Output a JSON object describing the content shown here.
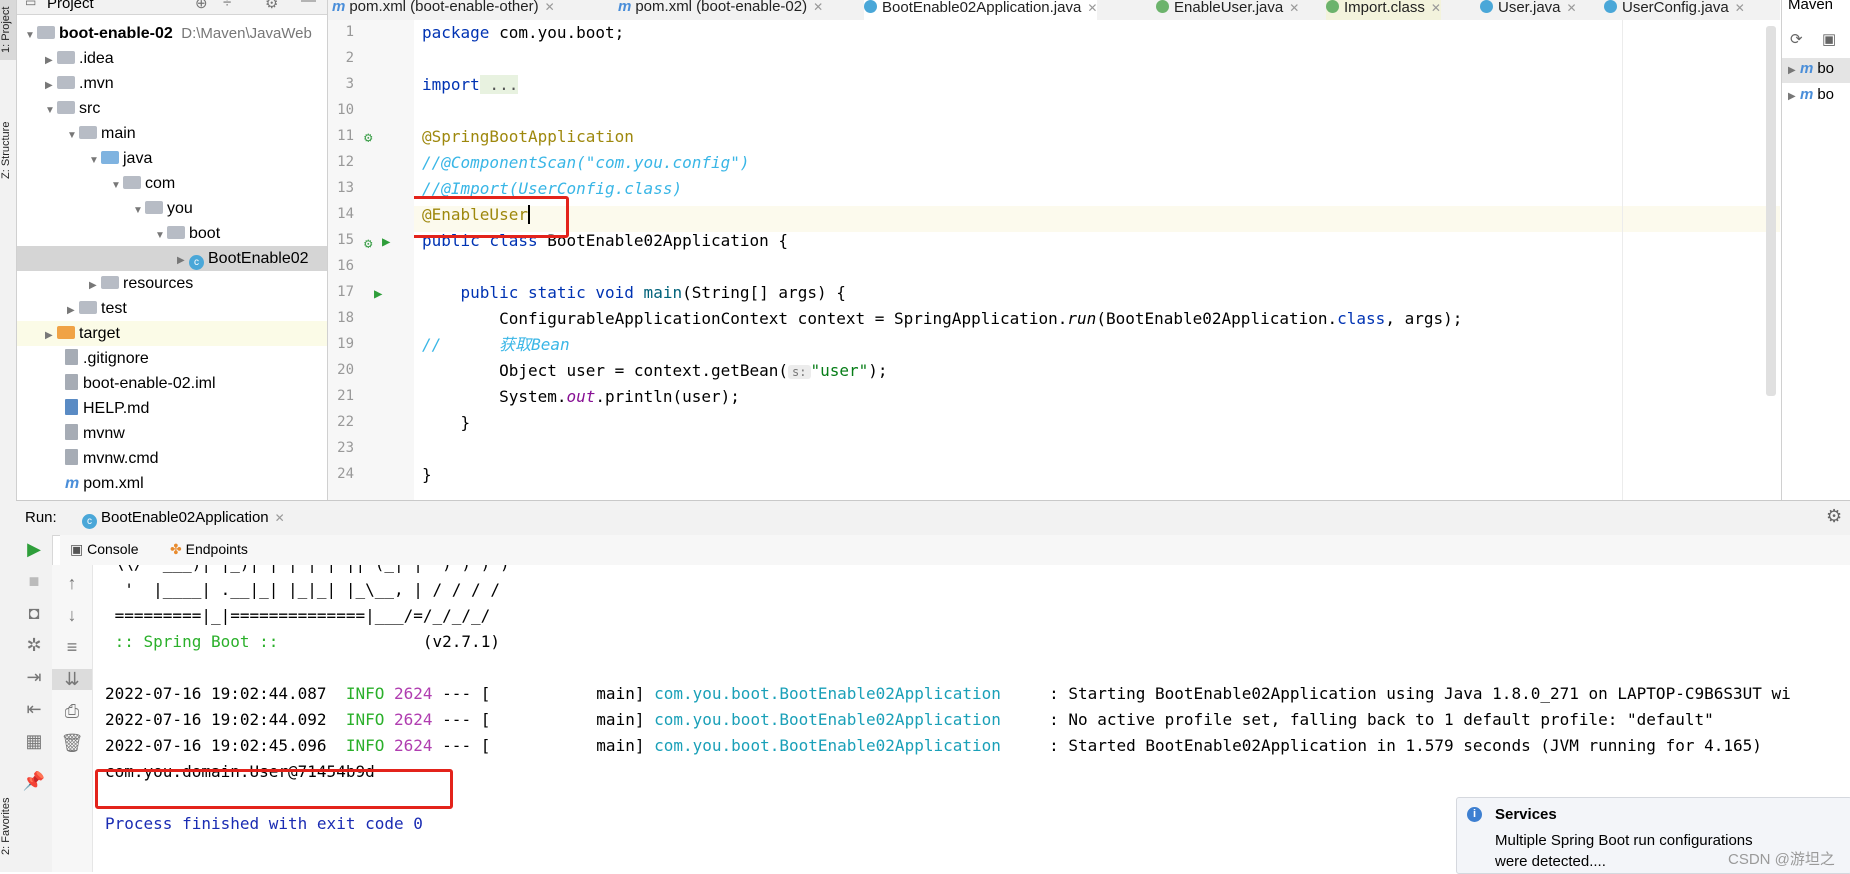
{
  "left_strip": {
    "project_tab": "1: Project",
    "structure_tab": "Z: Structure",
    "favorites_tab": "2: Favorites"
  },
  "project": {
    "header": "Project",
    "tree": [
      {
        "label": "boot-enable-02",
        "path": "D:\\Maven\\JavaWeb",
        "kind": "root"
      },
      {
        "label": ".idea",
        "kind": "folder"
      },
      {
        "label": ".mvn",
        "kind": "folder"
      },
      {
        "label": "src",
        "kind": "folder"
      },
      {
        "label": "main",
        "kind": "folder"
      },
      {
        "label": "java",
        "kind": "folder-blue"
      },
      {
        "label": "com",
        "kind": "folder"
      },
      {
        "label": "you",
        "kind": "folder"
      },
      {
        "label": "boot",
        "kind": "folder"
      },
      {
        "label": "BootEnable02",
        "kind": "class"
      },
      {
        "label": "resources",
        "kind": "folder"
      },
      {
        "label": "test",
        "kind": "folder"
      },
      {
        "label": "target",
        "kind": "folder-orange"
      },
      {
        "label": ".gitignore",
        "kind": "file"
      },
      {
        "label": "boot-enable-02.iml",
        "kind": "file"
      },
      {
        "label": "HELP.md",
        "kind": "file"
      },
      {
        "label": "mvnw",
        "kind": "file"
      },
      {
        "label": "mvnw.cmd",
        "kind": "file"
      },
      {
        "label": "pom.xml",
        "kind": "maven"
      }
    ]
  },
  "tabs": [
    {
      "label": "pom.xml (boot-enable-other)"
    },
    {
      "label": "pom.xml (boot-enable-02)"
    },
    {
      "label": "BootEnable02Application.java"
    },
    {
      "label": "EnableUser.java"
    },
    {
      "label": "Import.class"
    },
    {
      "label": "User.java"
    },
    {
      "label": "UserConfig.java"
    }
  ],
  "maven": {
    "title": "Maven",
    "items": [
      "bo",
      "bo"
    ]
  },
  "editor": {
    "line_numbers": [
      "1",
      "2",
      "3",
      "10",
      "11",
      "12",
      "13",
      "14",
      "15",
      "16",
      "17",
      "18",
      "19",
      "20",
      "21",
      "22",
      "23",
      "24"
    ],
    "code": {
      "l1_kw": "package",
      "l1_rest": " com.you.boot;",
      "l3_kw": "import",
      "l3_rest": " ...",
      "l11": "@SpringBootApplication",
      "l12": "//@ComponentScan(\"com.you.config\")",
      "l13": "//@Import(UserConfig.class)",
      "l14": "@EnableUser",
      "l15_kw": "public class",
      "l15_rest": " BootEnable02Application {",
      "l17_kw": "public static void",
      "l17_m": " main",
      "l17_rest": "(String[] args) {",
      "l18_a": "ConfigurableApplicationContext context = SpringApplication.",
      "l18_m": "run",
      "l18_b": "(BootEnable02Application.",
      "l18_kw": "class",
      "l18_c": ", args);",
      "l19_a": "//",
      "l19_b": "获取Bean",
      "l20_a": "Object user = context.getBean(",
      "l20_hint": "s:",
      "l20_str": "\"user\"",
      "l20_c": ");",
      "l21_a": "System.",
      "l21_out": "out",
      "l21_b": ".println(user);",
      "l22": "}",
      "l24": "}"
    }
  },
  "run": {
    "label": "Run:",
    "config": "BootEnable02Application",
    "console_tab": "Console",
    "endpoints_tab": "Endpoints",
    "banner": [
      " \\\\/  ___)| |_)| | | | | || (_| |  ) ) ) )",
      "  '  |____| .__|_| |_|_| |_\\__, | / / / /",
      " =========|_|==============|___/=/_/_/_/"
    ],
    "spring_boot": " :: Spring Boot ::",
    "version": "(v2.7.1)",
    "logs": [
      {
        "time": "2022-07-16 19:02:44.087",
        "level": "INFO",
        "pid": "2624",
        "sep": "--- [           main]",
        "cls": "com.you.boot.BootEnable02Application",
        "msg": ": Starting BootEnable02Application using Java 1.8.0_271 on LAPTOP-C9B6S3UT wi"
      },
      {
        "time": "2022-07-16 19:02:44.092",
        "level": "INFO",
        "pid": "2624",
        "sep": "--- [           main]",
        "cls": "com.you.boot.BootEnable02Application",
        "msg": ": No active profile set, falling back to 1 default profile: \"default\""
      },
      {
        "time": "2022-07-16 19:02:45.096",
        "level": "INFO",
        "pid": "2624",
        "sep": "--- [           main]",
        "cls": "com.you.boot.BootEnable02Application",
        "msg": ": Started BootEnable02Application in 1.579 seconds (JVM running for 4.165)"
      }
    ],
    "output": "com.you.domain.User@71454b9d",
    "finished": "Process finished with exit code 0"
  },
  "services": {
    "title": "Services",
    "text1": "Multiple Spring Boot run configurations",
    "text2": "were detected...."
  },
  "watermark": "CSDN @游坦之"
}
